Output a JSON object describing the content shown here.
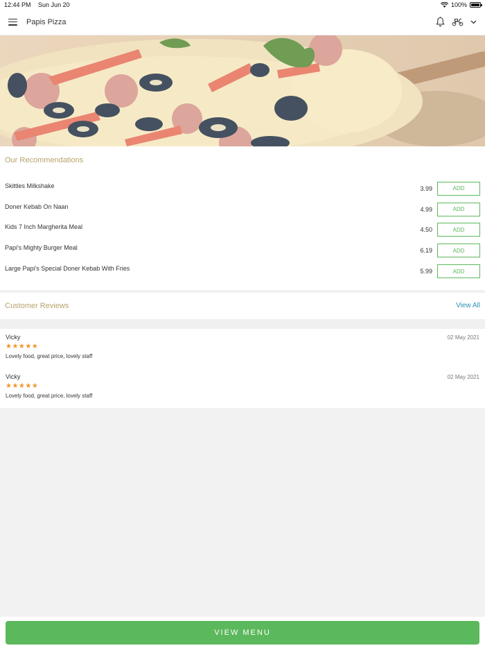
{
  "status_bar": {
    "time": "12:44 PM",
    "date": "Sun Jun 20",
    "battery": "100%"
  },
  "header": {
    "title": "Papis Pizza",
    "icons": [
      "menu-icon",
      "bell-icon",
      "scooter-icon",
      "chevron-down-icon"
    ]
  },
  "banner": {
    "image": "pizza-photo"
  },
  "recommendations": {
    "title": "Our Recommendations",
    "add_label": "ADD",
    "items": [
      {
        "name": "Skittles Milkshake",
        "price": "3.99"
      },
      {
        "name": "Doner Kebab On Naan",
        "price": "4.99"
      },
      {
        "name": "Kids 7 Inch Margherita Meal",
        "price": "4.50"
      },
      {
        "name": "Papi's Mighty Burger Meal",
        "price": "6.19"
      },
      {
        "name": "Large Papi's Special Doner Kebab With Fries",
        "price": "5.99"
      }
    ]
  },
  "reviews": {
    "title": "Customer Reviews",
    "view_all": "View All",
    "items": [
      {
        "author": "Vicky",
        "date": "02 May 2021",
        "rating": 5,
        "stars": "★★★★★",
        "text": "Lovely food, great price, lovely staff"
      },
      {
        "author": "Vicky",
        "date": "02 May 2021",
        "rating": 5,
        "stars": "★★★★★",
        "text": "Lovely food, great price, lovely staff"
      }
    ]
  },
  "footer": {
    "view_menu": "VIEW MENU"
  },
  "colors": {
    "accent_green": "#5cb85c",
    "section_title": "#b9a26c",
    "link_blue": "#2a8fb4",
    "star_orange": "#f0962a"
  }
}
